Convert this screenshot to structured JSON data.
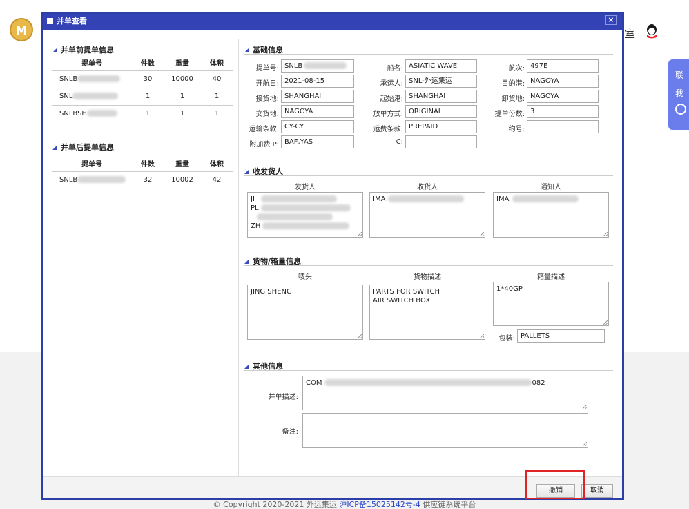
{
  "background": {
    "logo_text": "M",
    "room_text": "室",
    "side_lines": [
      "联",
      "我"
    ],
    "footer_text": "© Copyright 2020-2021 外运集运",
    "footer_link": "沪ICP备15025142号-4",
    "footer_suffix": "供应链系统平台"
  },
  "modal": {
    "title": "并单查看",
    "close": "×",
    "before": {
      "title": "并单前提单信息",
      "headers": [
        "提单号",
        "件数",
        "重量",
        "体积"
      ],
      "rows": [
        {
          "bl": "SNLB",
          "qty": "30",
          "weight": "10000",
          "volume": "40"
        },
        {
          "bl": "SNL",
          "qty": "1",
          "weight": "1",
          "volume": "1"
        },
        {
          "bl": "SNLBSH",
          "qty": "1",
          "weight": "1",
          "volume": "1"
        }
      ]
    },
    "after": {
      "title": "并单后提单信息",
      "headers": [
        "提单号",
        "件数",
        "重量",
        "体积"
      ],
      "rows": [
        {
          "bl": "SNLB",
          "qty": "32",
          "weight": "10002",
          "volume": "42"
        }
      ]
    },
    "basic": {
      "title": "基础信息",
      "bl_no_label": "提单号:",
      "bl_no": "SNLB",
      "vessel_label": "船名:",
      "vessel": "ASIATIC WAVE",
      "voyage_label": "航次:",
      "voyage": "497E",
      "sail_date_label": "开航日:",
      "sail_date": "2021-08-15",
      "carrier_label": "承运人:",
      "carrier": "SNL-外运集运",
      "dest_port_label": "目的港:",
      "dest_port": "NAGOYA",
      "receipt_label": "接货地:",
      "receipt": "SHANGHAI",
      "pol_label": "起始港:",
      "pol": "SHANGHAI",
      "pod_label": "卸货地:",
      "pod": "NAGOYA",
      "delivery_label": "交货地:",
      "delivery": "NAGOYA",
      "release_label": "放单方式:",
      "release": "ORIGINAL",
      "copies_label": "提单份数:",
      "copies": "3",
      "transport_label": "运输条款:",
      "transport": "CY-CY",
      "freight_label": "运费条款:",
      "freight": "PREPAID",
      "contract_label": "约号:",
      "contract": "",
      "surcharge_label": "附加费 P:",
      "surcharge": "BAF,YAS",
      "c_label": "C:",
      "c_value": ""
    },
    "parties": {
      "title": "收发货人",
      "shipper_head": "发货人",
      "consignee_head": "收货人",
      "notify_head": "通知人",
      "shipper": "JI\nPL\n\nZH",
      "consignee": "IMA",
      "notify": "IMA"
    },
    "cargo": {
      "title": "货物/箱量信息",
      "marks_head": "唛头",
      "desc_head": "货物描述",
      "container_head": "箱量描述",
      "marks": "JING SHENG",
      "desc": "PARTS FOR SWITCH\nAIR SWITCH BOX",
      "container": "1*40GP",
      "package_label": "包装:",
      "package": "PALLETS"
    },
    "other": {
      "title": "其他信息",
      "merge_desc_label": "并单描述:",
      "merge_desc_start": "COM",
      "merge_desc_end": "082",
      "remark_label": "备注:",
      "remark": ""
    },
    "buttons": {
      "revoke": "撤销",
      "cancel": "取消"
    }
  }
}
